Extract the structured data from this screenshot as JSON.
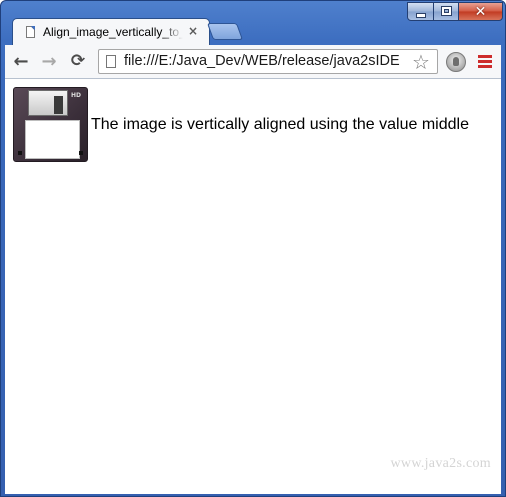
{
  "window": {
    "controls": {
      "minimize_icon": "minimize-icon",
      "maximize_icon": "maximize-icon",
      "close_icon": "close-icon",
      "close_glyph": "✕"
    }
  },
  "tabs": [
    {
      "title": "Align_image_vertically_to_",
      "close_glyph": "×",
      "active": true
    }
  ],
  "toolbar": {
    "back_glyph": "←",
    "forward_glyph": "→",
    "reload_glyph": "⟳",
    "address": "file:///E:/Java_Dev/WEB/release/java2sIDE",
    "bookmark_glyph": "☆"
  },
  "page": {
    "image_icon": "floppy-disk-icon",
    "floppy_badge": "HD",
    "text": "The image is vertically aligned using the value middle",
    "watermark": "www.java2s.com"
  },
  "colors": {
    "frame": "#3d6ec0",
    "menu_accent": "#cd2c2c"
  }
}
